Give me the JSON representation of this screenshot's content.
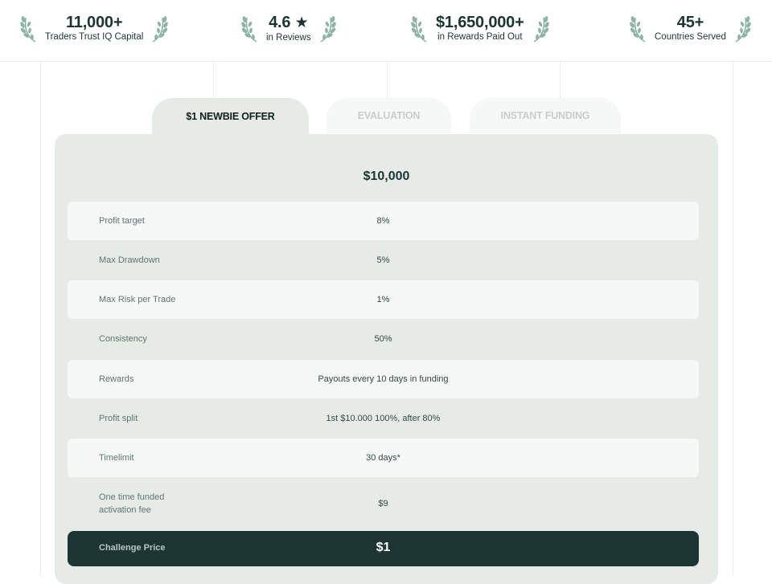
{
  "stats": [
    {
      "value": "11,000+",
      "label": "Traders Trust IQ Capital"
    },
    {
      "value": "4.6",
      "star": "★",
      "label": "in Reviews"
    },
    {
      "value": "$1,650,000+",
      "label": "in Rewards Paid Out"
    },
    {
      "value": "45+",
      "label": "Countries Served"
    }
  ],
  "tabs": [
    {
      "label": "$1 NEWBIE OFFER",
      "active": true
    },
    {
      "label": "EVALUATION",
      "active": false
    },
    {
      "label": "INSTANT FUNDING",
      "active": false
    }
  ],
  "plan": {
    "amount": "$10,000",
    "rows": [
      {
        "label": "Profit target",
        "value": "8%"
      },
      {
        "label": "Max Drawdown",
        "value": "5%"
      },
      {
        "label": "Max Risk per Trade",
        "value": "1%"
      },
      {
        "label": "Consistency",
        "value": "50%"
      },
      {
        "label": "Rewards",
        "value": "Payouts every 10 days in funding"
      },
      {
        "label": "Profit split",
        "value": "1st $10.000 100%, after 80%"
      },
      {
        "label": "Timelimit",
        "value": "30 days*"
      },
      {
        "label_line1": "One time funded",
        "label_line2": "activation fee",
        "value": "$9"
      }
    ],
    "price_label": "Challenge Price",
    "price_value": "$1"
  },
  "colors": {
    "dark": "#1c3432",
    "panel": "#e6ebe8",
    "row_light": "#f6f8f7",
    "laurel": "#8db3a5"
  },
  "icons": [
    "laurel-left-icon",
    "laurel-right-icon",
    "star-icon"
  ]
}
